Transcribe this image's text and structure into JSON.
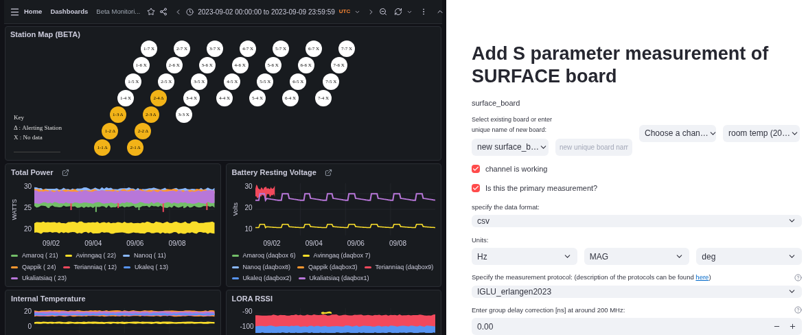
{
  "dashboard": {
    "breadcrumbs": [
      {
        "label": "Home"
      },
      {
        "label": "Dashboards"
      },
      {
        "label": "Beta Monitori..."
      }
    ],
    "time_range": "2023-09-02 00:00:00 to 2023-09-09 23:59:59",
    "timezone": "UTC",
    "station_map": {
      "title": "Station Map (BETA)",
      "key": [
        "Key",
        "Δ : Alerting Station",
        "X : No data"
      ],
      "rows": [
        {
          "stations": [
            {
              "label": "1-7 X",
              "kind": "nodata"
            },
            {
              "label": "2-7 X",
              "kind": "nodata"
            },
            {
              "label": "3-7 X",
              "kind": "nodata"
            },
            {
              "label": "4-7 X",
              "kind": "nodata"
            },
            {
              "label": "5-7 X",
              "kind": "nodata"
            },
            {
              "label": "6-7 X",
              "kind": "nodata"
            },
            {
              "label": "7-7 X",
              "kind": "nodata"
            }
          ]
        },
        {
          "stations": [
            {
              "label": "1-6 X",
              "kind": "nodata"
            },
            {
              "label": "2-6 X",
              "kind": "nodata"
            },
            {
              "label": "3-6 X",
              "kind": "nodata"
            },
            {
              "label": "4-6 X",
              "kind": "nodata"
            },
            {
              "label": "5-6 X",
              "kind": "nodata"
            },
            {
              "label": "6-6 X",
              "kind": "nodata"
            },
            {
              "label": "7-6 X",
              "kind": "nodata"
            }
          ]
        },
        {
          "stations": [
            {
              "label": "1-5 X",
              "kind": "nodata"
            },
            {
              "label": "2-5 X",
              "kind": "nodata"
            },
            {
              "label": "3-5 X",
              "kind": "nodata"
            },
            {
              "label": "4-5 X",
              "kind": "nodata"
            },
            {
              "label": "5-5 X",
              "kind": "nodata"
            },
            {
              "label": "6-5 X",
              "kind": "nodata"
            },
            {
              "label": "7-5 X",
              "kind": "nodata"
            }
          ]
        },
        {
          "stations": [
            {
              "label": "1-4 X",
              "kind": "nodata"
            },
            {
              "label": "2-4 Δ",
              "kind": "alert"
            },
            {
              "label": "3-4 X",
              "kind": "nodata"
            },
            {
              "label": "4-4 X",
              "kind": "nodata"
            },
            {
              "label": "5-4 X",
              "kind": "nodata"
            },
            {
              "label": "6-4 X",
              "kind": "nodata"
            },
            {
              "label": "7-4 X",
              "kind": "nodata"
            }
          ]
        },
        {
          "stations": [
            {
              "label": "1-3 Δ",
              "kind": "alert"
            },
            {
              "label": "2-3 Δ",
              "kind": "alert"
            },
            {
              "label": "3-3 X",
              "kind": "nodata"
            }
          ]
        },
        {
          "stations": [
            {
              "label": "1-2 Δ",
              "kind": "alert"
            },
            {
              "label": "2-2 Δ",
              "kind": "alert"
            }
          ]
        },
        {
          "stations": [
            {
              "label": "1-1 Δ",
              "kind": "alert"
            },
            {
              "label": "2-1 Δ",
              "kind": "alert"
            }
          ]
        }
      ]
    },
    "panels": [
      {
        "title": "Total Power",
        "external_link": true,
        "kind": "power",
        "ylabel": "WATTS",
        "y_axis_labels": [
          "30",
          "25",
          "20"
        ],
        "x_axis_labels": [
          "09/02",
          "09/04",
          "09/06",
          "09/08"
        ],
        "legend": [
          {
            "name": "Amaroq ( 21)",
            "color": "#73bf69"
          },
          {
            "name": "Avinngaq ( 22)",
            "color": "#fade2a"
          },
          {
            "name": "Nanoq ( 11)",
            "color": "#8ab8ff"
          },
          {
            "name": "Qappik ( 24)",
            "color": "#ff9830"
          },
          {
            "name": "Terianniaq ( 12)",
            "color": "#f2495c"
          },
          {
            "name": "Ukaleq ( 13)",
            "color": "#5794f2"
          },
          {
            "name": "Ukaliatsiaq ( 23)",
            "color": "#b877d9"
          }
        ]
      },
      {
        "title": "Battery Resting Voltage",
        "external_link": true,
        "kind": "battery",
        "ylabel": "Volts",
        "y_axis_labels": [
          "30",
          "20",
          "10"
        ],
        "x_axis_labels": [
          "09/02",
          "09/04",
          "09/06",
          "09/08"
        ],
        "legend": [
          {
            "name": "Amaroq (daqbox 6)",
            "color": "#73bf69"
          },
          {
            "name": "Avinngaq (daqbox 7)",
            "color": "#fade2a"
          },
          {
            "name": "Nanoq (daqbox8)",
            "color": "#8ab8ff"
          },
          {
            "name": "Qappik (daqbox3)",
            "color": "#ff9830"
          },
          {
            "name": "Terianniaq (daqbox9)",
            "color": "#f2495c"
          },
          {
            "name": "Ukaleq (daqbox2)",
            "color": "#5794f2"
          },
          {
            "name": "Ukaliatsiaq (daqbox1)",
            "color": "#b877d9"
          }
        ]
      },
      {
        "title": "Internal Temperature",
        "external_link": false,
        "kind": "temperature",
        "y_axis_labels": [
          "20",
          "0"
        ]
      },
      {
        "title": "LORA RSSI",
        "external_link": false,
        "kind": "rssi",
        "y_axis_labels": [
          "-90",
          "-100"
        ]
      }
    ]
  },
  "form": {
    "title": "Add S parameter measurement of SURFACE board",
    "subtitle": "surface_board",
    "board_row": {
      "label": "Select existing board or enter unique name of new board:",
      "board_select": "new surface_b…",
      "name_placeholder": "new unique board nam",
      "channel_select": "Choose a chan…",
      "condition_select": "room temp (20…"
    },
    "checkboxes": [
      {
        "label": "channel is working",
        "checked": true
      },
      {
        "label": "Is this the primary measurement?",
        "checked": true
      }
    ],
    "data_format": {
      "label": "specify the data format:",
      "value": "csv"
    },
    "units": {
      "label": "Units:",
      "values": [
        "Hz",
        "MAG",
        "deg"
      ]
    },
    "protocol": {
      "label_start": "Specify the measurement protocol: (description of the protocols can be found ",
      "link": "here",
      "label_end": ")",
      "value": "IGLU_erlangen2023"
    },
    "delay": {
      "label": "Enter group delay correction [ns] at around 200 MHz:",
      "value": "0.00"
    }
  }
}
